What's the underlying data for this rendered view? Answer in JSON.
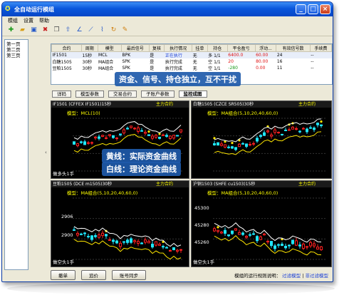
{
  "window": {
    "title": "全自动运行模组",
    "min": "_",
    "max": "□",
    "close": "×"
  },
  "menu": [
    "模组",
    "设置",
    "帮助"
  ],
  "sidebar": {
    "items": [
      "第一页",
      "第二页",
      "第三页"
    ]
  },
  "grid": {
    "columns": [
      "合约",
      "周期",
      "模型",
      "最后信号",
      "复核",
      "执行情况",
      "挂单",
      "持仓",
      "平仓盈亏",
      "浮动...",
      "有效信号数",
      "手续费"
    ],
    "rows": [
      [
        "IF1501",
        "15秒",
        "MCL",
        "BPK",
        "是",
        "正在执行",
        "无",
        "多 1/1",
        "6400.0",
        "60.00",
        "24",
        "--"
      ],
      [
        "白糖1505",
        "30秒",
        "MA组合",
        "SPK",
        "是",
        "执行完成",
        "无",
        "空 1/1",
        "20",
        "80.00",
        "16",
        "--"
      ],
      [
        "豆粕1505",
        "30秒",
        "MA组合",
        "SPK",
        "是",
        "执行完成",
        "无",
        "空 1/1",
        "-280",
        "0.00",
        "11",
        "--"
      ]
    ]
  },
  "banners": {
    "top": "资金、信号、持仓独立，互不干扰",
    "line1": "黄线：实际资金曲线",
    "line2": "白线：理论资金曲线"
  },
  "tabs": [
    "详码",
    "模型参数",
    "交易合约",
    "子账户参数",
    "监控成图"
  ],
  "panels": [
    {
      "title": "IF1501 (CFFEX IF1501)15秒",
      "right": "主力合约",
      "model": "模型：MCL(10)",
      "pos": "做多头1手",
      "price_labels": []
    },
    {
      "title": "白糖1505 (CZCE SR505)30秒",
      "right": "主力合约",
      "model": "模型：MA组合(5,10,20,40,60,0)",
      "pos": "",
      "price_labels": []
    },
    {
      "title": "豆粕1505 (DCE m1505)30秒",
      "right": "主力合约",
      "model": "模型：MA组合(5,10,20,40,60,0)",
      "pos": "做空头1手",
      "price_labels": [
        "2906",
        "2900"
      ]
    },
    {
      "title": "沪铜1503 (SHFE cu1503)15秒",
      "right": "主力合约",
      "model": "模型：MA组合(5,10,20,40,60,0)",
      "pos": "做空头1手",
      "price_labels": [
        "45300",
        "45280",
        "45260"
      ]
    }
  ],
  "bottom": {
    "buttons": [
      "撤单",
      "追价",
      "账号同步"
    ],
    "note_label": "模组的运行规则说明：",
    "note_filter": "过滤模型",
    "note_nofilter": "非过滤模型"
  },
  "colors": {
    "yellow": "#ffe600",
    "red": "#ff2020",
    "cyan": "#20e8ff",
    "white": "#ffffff",
    "frame": "#0a56dc"
  }
}
